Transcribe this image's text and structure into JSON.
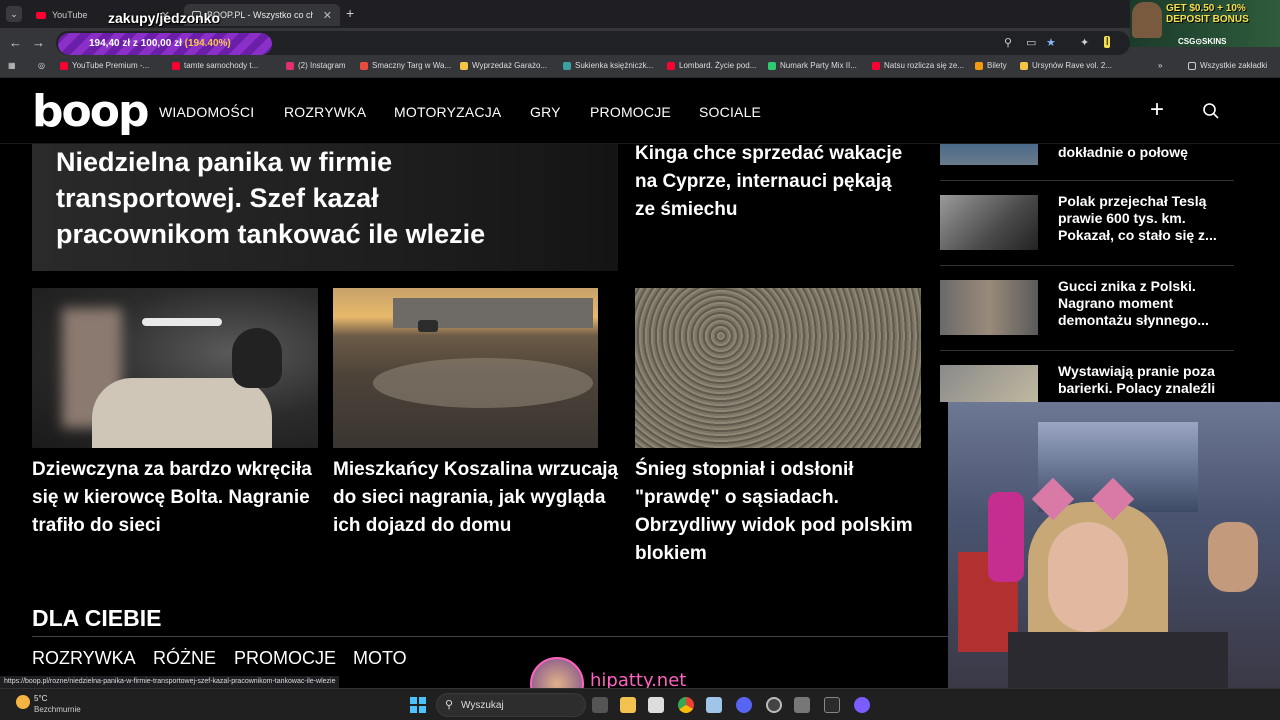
{
  "browser": {
    "tabs": [
      {
        "label": "YouTube"
      },
      {
        "label": "BOOP.PL - Wszystko co chcesz"
      }
    ],
    "overlay_title": "zakupy/jedzonko",
    "new_tab_symbol": "+",
    "tab_menu_symbol": "⌄",
    "close_symbol": "✕",
    "back_symbol": "←",
    "forward_symbol": "→",
    "money_pill": {
      "text": "194,40 zł z 100,00 zł ",
      "pct": "(194.40%)"
    },
    "bookmarks": [
      {
        "label": "YouTube Premium -...",
        "color": "#ff0033"
      },
      {
        "label": "tamte samochody t...",
        "color": "#ff0033"
      },
      {
        "label": "(2) Instagram",
        "color": "#e1306c"
      },
      {
        "label": "Smaczny Targ w Wa...",
        "color": "#e74c3c"
      },
      {
        "label": "Wyprzedaż Garażo...",
        "color": "#f4c542"
      },
      {
        "label": "Sukienka księżniczk...",
        "color": "#3aa0a0"
      },
      {
        "label": "Lombard. Życie pod...",
        "color": "#ff0033"
      },
      {
        "label": "Numark Party Mix II...",
        "color": "#2ecc71"
      },
      {
        "label": "Natsu rozlicza się ze...",
        "color": "#ff0033"
      },
      {
        "label": "Bilety",
        "color": "#f39c12"
      },
      {
        "label": "Ursynów Rave vol. 2...",
        "color": "#f4c542"
      }
    ],
    "bookmarks_more": "»",
    "all_bookmarks": "Wszystkie zakładki"
  },
  "ad": {
    "title": "GET $0.50 + 10% DEPOSIT BONUS",
    "brand": "CSG⊙SKINS"
  },
  "site": {
    "logo": "boop",
    "nav": [
      "WIADOMOŚCI",
      "ROZRYWKA",
      "MOTORYZACJA",
      "GRY",
      "PROMOCJE",
      "SOCIALE"
    ],
    "plus_symbol": "+"
  },
  "main": {
    "hero_title": "Niedzielna panika w firmie transportowej. Szef kazał pracownikom tankować ile wlezie",
    "side_top_title": "Kinga chce sprzedać wakacje na Cyprze, internauci pękają ze śmiechu",
    "cards": [
      {
        "title": "Dziewczyna za bardzo wkręciła się w kierowcę Bolta. Nagranie trafiło do sieci"
      },
      {
        "title": "Mieszkańcy Koszalina wrzucają do sieci nagrania, jak wygląda ich dojazd do domu"
      },
      {
        "title": "Śnieg stopniał i odsłonił \"prawdę\" o sąsiadach. Obrzydliwy widok pod polskim blokiem"
      }
    ]
  },
  "sidebar": {
    "items": [
      {
        "title": "dokładnie o połowę"
      },
      {
        "title": "Polak przejechał Teslą prawie 600 tys. km. Pokazał, co stało się z..."
      },
      {
        "title": "Gucci znika z Polski. Nagrano moment demontażu słynnego..."
      },
      {
        "title": "Wystawiają pranie poza barierki. Polacy znaleźli"
      }
    ]
  },
  "bottom": {
    "section_title": "DLA CIEBIE",
    "categories": [
      "ROZRYWKA",
      "RÓŻNE",
      "PROMOCJE",
      "MOTO"
    ]
  },
  "status_url": "https://boop.pl/rozne/niedzielna-panika-w-firmie-transportowej-szef-kazal-pracownikom-tankowac-ile-wlezie",
  "brand_overlay": "hipatty.net",
  "taskbar": {
    "weather_temp": "5°C",
    "weather_desc": "Bezchmurnie",
    "search_label": "Wyszukaj",
    "search_symbol": "⚲"
  }
}
